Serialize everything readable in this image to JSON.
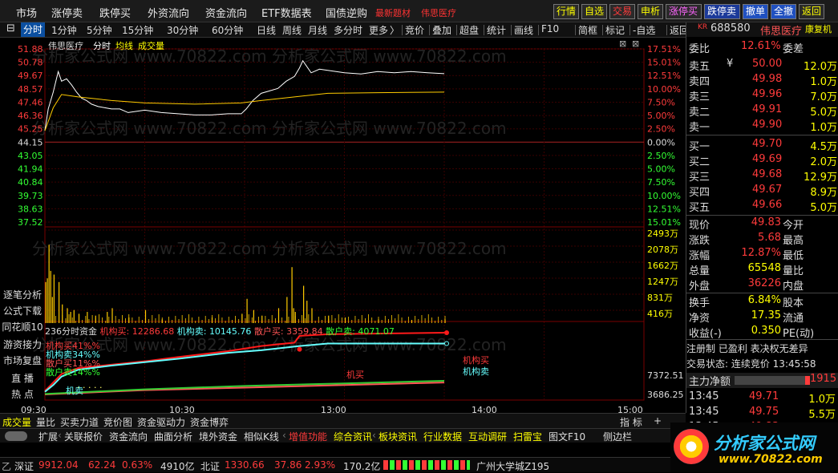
{
  "menu": {
    "items": [
      "市场",
      "涨停卖",
      "跌停买",
      "外资流向",
      "资金流向",
      "ETF数据表",
      "国债逆购"
    ],
    "red_links": [
      "最新题材",
      "伟思医疗"
    ],
    "right_buttons": [
      {
        "label": "行情",
        "color": "#ffff00",
        "bg": "#2a2a2a"
      },
      {
        "label": "自选",
        "color": "#ffff00",
        "bg": "#2a2a2a"
      },
      {
        "label": "交易",
        "color": "#ff3b3b",
        "bg": "#2a2a2a"
      },
      {
        "label": "申析",
        "color": "#ffff00",
        "bg": "#2a2a2a"
      },
      {
        "label": "涨停买",
        "color": "#ff66ff",
        "bg": "#2a2a2a"
      },
      {
        "label": "跌停卖",
        "color": "#ffffff",
        "bg": "#1c3a9a"
      },
      {
        "label": "撤单",
        "color": "#ffffff",
        "bg": "#2050c0"
      },
      {
        "label": "全撤",
        "color": "#ffffff",
        "bg": "#2050c0"
      },
      {
        "label": "返回",
        "color": "#ffff00",
        "bg": "#2a2a2a"
      }
    ]
  },
  "toolbar": {
    "period_tabs": [
      "分时",
      "1分钟",
      "5分钟",
      "15分钟",
      "30分钟",
      "60分钟",
      "日线",
      "周线",
      "月线",
      "多分时",
      "更多"
    ],
    "right_tools": [
      "竞价",
      "叠加",
      "超盘",
      "统计",
      "画线",
      "F10",
      "简框",
      "标记",
      "-自选",
      "返回"
    ]
  },
  "chart": {
    "stock_name": "伟思医疗",
    "mode": "分时",
    "avg_label": "均线",
    "vol_label": "成交量",
    "price_ticks": [
      "51.88",
      "50.78",
      "49.67",
      "48.57",
      "47.46",
      "46.36",
      "45.25",
      "44.15",
      "43.05",
      "41.94",
      "40.84",
      "39.73",
      "38.63",
      "37.52"
    ],
    "pct_ticks": [
      "17.51%",
      "15.01%",
      "12.51%",
      "10.00%",
      "7.50%",
      "5.00%",
      "2.50%",
      "0.00%",
      "2.50%",
      "5.00%",
      "7.50%",
      "10.00%",
      "12.51%",
      "15.01%"
    ],
    "vol_ticks": [
      "2493万",
      "2078万",
      "1662万",
      "1247万",
      "831万",
      "416万"
    ],
    "side_buttons": [
      "逐笔分析",
      "公式下载",
      "同花顺10",
      "游资接力",
      "市场复盘",
      "直 播",
      "热 点"
    ],
    "fund_bar": {
      "prefix": "236分时资金",
      "inst_buy_label": "机构买:",
      "inst_buy": "12286.68",
      "inst_sell_label": "机构卖:",
      "inst_sell": "10145.76",
      "retail_buy_label": "散户买:",
      "retail_buy": "3359.84",
      "retail_sell_label": "散户卖:",
      "retail_sell": "4071.07"
    },
    "fund_legend": [
      "机构买41%%",
      "机构卖34%%",
      "散户买11%%",
      "散户卖14%%"
    ],
    "fund_marks": [
      "机买",
      "机构买",
      "机构卖",
      "机卖"
    ],
    "fund_ticks": [
      "7372.51",
      "3686.25"
    ],
    "time_ticks": [
      "09:30",
      "10:30",
      "13:00",
      "14:00",
      "15:00"
    ],
    "watermark": "分析家公式网 www.70822.com"
  },
  "chart_data": {
    "type": "line",
    "price_series": [
      [
        0,
        45.1
      ],
      [
        2,
        46.9
      ],
      [
        5,
        48.3
      ],
      [
        8,
        50.0
      ],
      [
        10,
        49.2
      ],
      [
        13,
        49.4
      ],
      [
        16,
        48.9
      ],
      [
        19,
        48.3
      ],
      [
        22,
        47.8
      ],
      [
        25,
        47.6
      ],
      [
        28,
        47.3
      ],
      [
        32,
        47.1
      ],
      [
        36,
        47.0
      ],
      [
        40,
        46.9
      ],
      [
        45,
        46.9
      ],
      [
        50,
        46.6
      ],
      [
        55,
        46.7
      ],
      [
        60,
        46.8
      ],
      [
        70,
        46.6
      ],
      [
        80,
        46.5
      ],
      [
        90,
        46.4
      ],
      [
        100,
        46.4
      ],
      [
        110,
        46.5
      ],
      [
        118,
        46.5
      ],
      [
        121,
        46.9
      ],
      [
        125,
        47.6
      ],
      [
        130,
        48.2
      ],
      [
        135,
        48.4
      ],
      [
        140,
        48.6
      ],
      [
        145,
        49.2
      ],
      [
        150,
        49.6
      ],
      [
        153,
        50.3
      ],
      [
        155,
        50.9
      ],
      [
        160,
        49.9
      ],
      [
        165,
        50.2
      ],
      [
        170,
        50.1
      ],
      [
        180,
        49.9
      ],
      [
        190,
        49.8
      ],
      [
        200,
        50.0
      ],
      [
        210,
        49.9
      ],
      [
        220,
        50.0
      ],
      [
        230,
        49.9
      ],
      [
        240,
        49.83
      ]
    ],
    "avg_series": [
      [
        0,
        45.1
      ],
      [
        5,
        47.0
      ],
      [
        10,
        48.1
      ],
      [
        20,
        47.9
      ],
      [
        40,
        47.6
      ],
      [
        60,
        47.4
      ],
      [
        90,
        47.3
      ],
      [
        118,
        47.4
      ],
      [
        130,
        47.6
      ],
      [
        150,
        47.9
      ],
      [
        170,
        48.2
      ],
      [
        200,
        48.25
      ],
      [
        240,
        48.3
      ]
    ],
    "vol_spikes": [
      [
        0,
        1100
      ],
      [
        1,
        1200
      ],
      [
        2,
        2100
      ],
      [
        3,
        1400
      ],
      [
        4,
        700
      ],
      [
        5,
        1300
      ],
      [
        8,
        1100
      ],
      [
        10,
        500
      ],
      [
        13,
        400
      ],
      [
        15,
        300
      ],
      [
        17,
        350
      ],
      [
        20,
        250
      ],
      [
        25,
        300
      ],
      [
        30,
        200
      ],
      [
        37,
        300
      ],
      [
        40,
        400
      ],
      [
        50,
        150
      ],
      [
        60,
        350
      ],
      [
        70,
        100
      ],
      [
        100,
        150
      ],
      [
        118,
        250
      ],
      [
        121,
        650
      ],
      [
        125,
        350
      ],
      [
        130,
        200
      ],
      [
        140,
        400
      ],
      [
        145,
        700
      ],
      [
        148,
        1500
      ],
      [
        149,
        400
      ],
      [
        150,
        300
      ],
      [
        155,
        1000
      ],
      [
        157,
        600
      ],
      [
        160,
        400
      ],
      [
        170,
        200
      ],
      [
        180,
        150
      ],
      [
        200,
        100
      ],
      [
        220,
        80
      ],
      [
        240,
        100
      ]
    ],
    "inst_buy": [
      [
        0,
        500
      ],
      [
        5,
        1500
      ],
      [
        10,
        2500
      ],
      [
        20,
        3200
      ],
      [
        40,
        3600
      ],
      [
        60,
        4000
      ],
      [
        80,
        4500
      ],
      [
        110,
        5200
      ],
      [
        130,
        5800
      ],
      [
        150,
        6200
      ],
      [
        153,
        7000
      ],
      [
        170,
        7200
      ],
      [
        240,
        7372
      ]
    ],
    "inst_sell": [
      [
        0,
        400
      ],
      [
        5,
        1200
      ],
      [
        10,
        2200
      ],
      [
        20,
        3000
      ],
      [
        40,
        3500
      ],
      [
        60,
        3900
      ],
      [
        80,
        4300
      ],
      [
        110,
        5000
      ],
      [
        130,
        5300
      ],
      [
        153,
        5800
      ],
      [
        170,
        6100
      ],
      [
        240,
        6100
      ]
    ],
    "retail_buy": [
      [
        0,
        100
      ],
      [
        60,
        600
      ],
      [
        120,
        900
      ],
      [
        180,
        1200
      ],
      [
        240,
        1500
      ]
    ],
    "retail_sell": [
      [
        0,
        150
      ],
      [
        60,
        700
      ],
      [
        120,
        1100
      ],
      [
        180,
        1400
      ],
      [
        240,
        1700
      ]
    ],
    "pre_close": 44.15,
    "price_min": 37.52,
    "price_max": 51.88,
    "vol_max": 2493,
    "fund_max": 7372.51
  },
  "quote": {
    "code": "688580",
    "name": "伟思医疗",
    "tag": "康复机",
    "webi_label": "委比",
    "webi": "12.61%",
    "weicha_label": "委差",
    "asks": [
      {
        "label": "卖五",
        "price": "50.00",
        "vol": "12.0万"
      },
      {
        "label": "卖四",
        "price": "49.98",
        "vol": "1.0万"
      },
      {
        "label": "卖三",
        "price": "49.96",
        "vol": "7.0万"
      },
      {
        "label": "卖二",
        "price": "49.91",
        "vol": "5.0万"
      },
      {
        "label": "卖一",
        "price": "49.90",
        "vol": "1.0万"
      }
    ],
    "bids": [
      {
        "label": "买一",
        "price": "49.70",
        "vol": "4.5万"
      },
      {
        "label": "买二",
        "price": "49.69",
        "vol": "2.0万"
      },
      {
        "label": "买三",
        "price": "49.68",
        "vol": "12.9万"
      },
      {
        "label": "买四",
        "price": "49.67",
        "vol": "8.9万"
      },
      {
        "label": "买五",
        "price": "49.66",
        "vol": "5.0万"
      }
    ],
    "stats": [
      {
        "l1": "现价",
        "v1": "49.83",
        "l2": "今开",
        "c": "#ff3b3b"
      },
      {
        "l1": "涨跌",
        "v1": "5.68",
        "l2": "最高",
        "c": "#ff3b3b"
      },
      {
        "l1": "涨幅",
        "v1": "12.87%",
        "l2": "最低",
        "c": "#ff3b3b"
      },
      {
        "l1": "总量",
        "v1": "65548",
        "l2": "量比",
        "c": "#ffff00"
      },
      {
        "l1": "外盘",
        "v1": "36226",
        "l2": "内盘",
        "c": "#ff3b3b"
      },
      {
        "l1": "换手",
        "v1": "6.84%",
        "l2": "股本",
        "c": "#ffff00"
      },
      {
        "l1": "净资",
        "v1": "17.35",
        "l2": "流通",
        "c": "#ffff00"
      },
      {
        "l1": "收益(-)",
        "v1": "0.350",
        "l2": "PE(动)",
        "c": "#ffff00"
      }
    ],
    "tags": "注册制 已盈利 表决权无差异",
    "trade_status": "交易状态: 连续竞价 13:45:58",
    "mainflow_label": "主力净额",
    "mainflow": "1915",
    "ticks": [
      {
        "t": "13:45",
        "p": "49.71",
        "v": "1.0万"
      },
      {
        "t": "13:45",
        "p": "49.75",
        "v": "5.5万"
      },
      {
        "t": "13:45",
        "p": "49.83",
        "v": "2.5万"
      }
    ]
  },
  "bottom_tabs": [
    "成交量",
    "量比",
    "买卖力道",
    "竞价图",
    "资金驱动力",
    "资金博弈"
  ],
  "bottom_right": [
    "指 标",
    "+"
  ],
  "nav": {
    "items": [
      "扩展",
      "关联报价",
      "资金流向",
      "曲面分析",
      "境外资金",
      "相似K线",
      "增值功能",
      "综合资讯",
      "板块资讯",
      "行业数据",
      "互动调研",
      "扫雷宝",
      "图文F10",
      "侧边栏"
    ]
  },
  "status": {
    "label0": "乙",
    "sz_label": "深证",
    "sz_val": "9912.04",
    "sz_chg": "62.24",
    "sz_pct": "0.63%",
    "sz_amt": "4910亿",
    "bz_label": "北证",
    "bz_val": "1330.66",
    "bz_chg": "37.86",
    "bz_pct": "2.93%",
    "bz_amt": "170.2亿",
    "news": "广州大学城Z195"
  },
  "logo": {
    "text": "分析家公式网",
    "url": "www.70822.com"
  }
}
